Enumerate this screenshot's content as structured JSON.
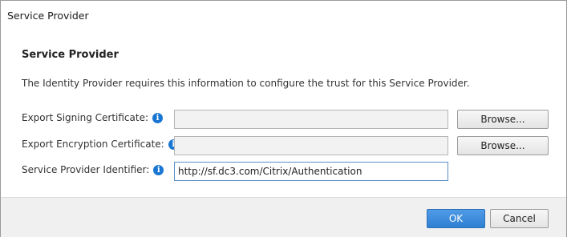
{
  "window": {
    "title": "Service Provider"
  },
  "section": {
    "heading": "Service Provider",
    "description": "The Identity Provider requires this information to configure the trust for this Service Provider."
  },
  "fields": [
    {
      "label": "Export Signing Certificate:",
      "value": "",
      "button_label": "Browse..."
    },
    {
      "label": "Export Encryption Certificate:",
      "value": "",
      "button_label": "Browse..."
    },
    {
      "label": "Service Provider Identifier:",
      "value": "http://sf.dc3.com/Citrix/Authentication"
    }
  ],
  "info_icon_glyph": "i",
  "footer": {
    "ok_label": "OK",
    "cancel_label": "Cancel"
  },
  "colors": {
    "accent": "#2f7fd2",
    "info_icon": "#1976d2"
  }
}
